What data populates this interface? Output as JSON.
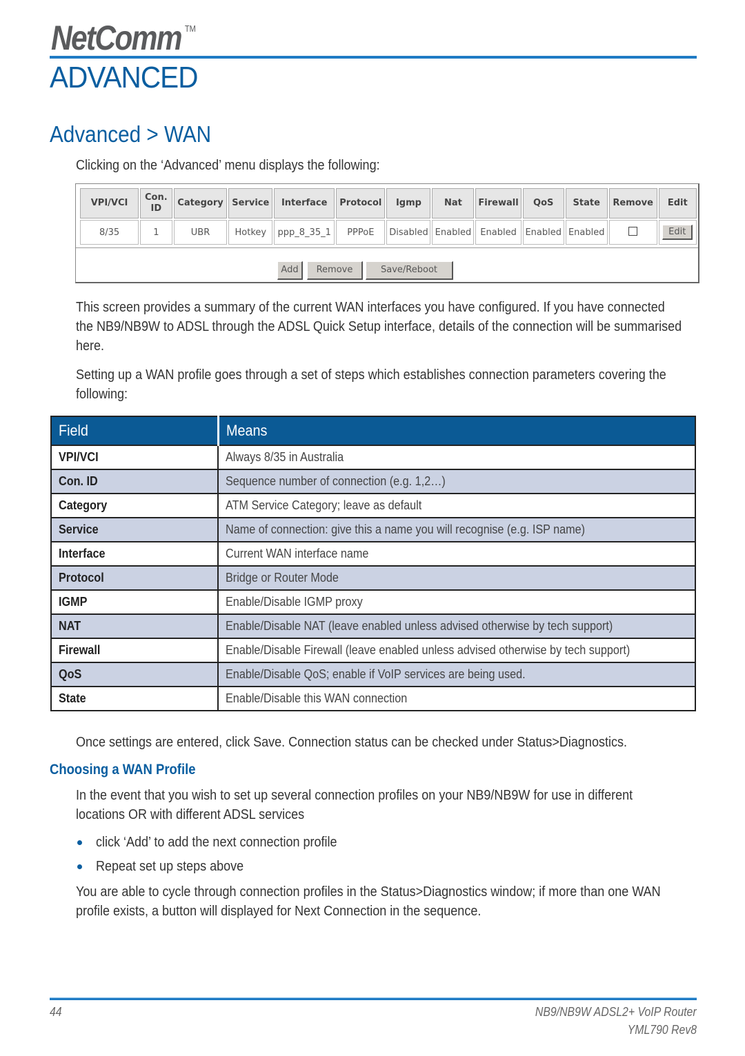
{
  "header": {
    "logo_text": "NetComm",
    "logo_tm": "TM",
    "chapter_title": "ADVANCED"
  },
  "section_title": "Advanced > WAN",
  "intro": "Clicking on the ‘Advanced’ menu displays the following:",
  "screenshot": {
    "columns": [
      "VPI/VCI",
      "Con. ID",
      "Category",
      "Service",
      "Interface",
      "Protocol",
      "Igmp",
      "Nat",
      "Firewall",
      "QoS",
      "State",
      "Remove",
      "Edit"
    ],
    "rows": [
      {
        "vpi_vci": "8/35",
        "con_id": "1",
        "category": "UBR",
        "service": "Hotkey",
        "interface": "ppp_8_35_1",
        "protocol": "PPPoE",
        "igmp": "Disabled",
        "nat": "Enabled",
        "firewall": "Enabled",
        "qos": "Enabled",
        "state": "Enabled",
        "remove_checked": false,
        "edit_label": "Edit"
      }
    ],
    "buttons": {
      "add": "Add",
      "remove": "Remove",
      "save_reboot": "Save/Reboot"
    }
  },
  "paragraphs": {
    "p1": "This screen provides a summary of the current WAN interfaces you have configured.  If you have connected the NB9/NB9W to ADSL through the ADSL Quick Setup interface, details of the connection will be summarised here.",
    "p2": "Setting up a WAN profile goes through a set of steps which establishes connection parameters covering the following:",
    "p3": "Once settings are entered, click Save.  Connection status can be checked under Status>Diagnostics."
  },
  "field_table": {
    "headers": [
      "Field",
      "Means"
    ],
    "rows": [
      {
        "field": "VPI/VCI",
        "means": "Always 8/35 in Australia"
      },
      {
        "field": "Con. ID",
        "means": "Sequence number of connection (e.g. 1,2…)"
      },
      {
        "field": "Category",
        "means": "ATM Service Category; leave as default"
      },
      {
        "field": "Service",
        "means": "Name of connection: give this a name you will recognise (e.g. ISP name)"
      },
      {
        "field": "Interface",
        "means": "Current WAN interface name"
      },
      {
        "field": "Protocol",
        "means": "Bridge or Router Mode"
      },
      {
        "field": "IGMP",
        "means": "Enable/Disable IGMP proxy"
      },
      {
        "field": "NAT",
        "means": "Enable/Disable NAT (leave enabled unless advised otherwise by tech support)"
      },
      {
        "field": "Firewall",
        "means": "Enable/Disable Firewall (leave enabled unless advised otherwise by tech support)"
      },
      {
        "field": "QoS",
        "means": "Enable/Disable QoS; enable if VoIP services are being used."
      },
      {
        "field": "State",
        "means": "Enable/Disable this WAN connection"
      }
    ]
  },
  "profile": {
    "heading": "Choosing a WAN Profile",
    "p1": "In the event that you wish to set up several connection profiles on your NB9/NB9W for use in different locations OR with different ADSL services",
    "bullets": [
      "click ‘Add’ to add the next connection profile",
      "Repeat set up steps above"
    ],
    "p2": "You are able to cycle through connection profiles in the Status>Diagnostics window; if more than one WAN profile exists, a button will displayed for Next Connection in the sequence."
  },
  "footer": {
    "page_number": "44",
    "product": "NB9/NB9W ADSL2+ VoIP Router",
    "doc_code": "YML790 Rev8"
  },
  "colors": {
    "brand_blue": "#0a5ea0",
    "table_header": "#0b5a95",
    "alt_row": "#cbd2e3"
  }
}
